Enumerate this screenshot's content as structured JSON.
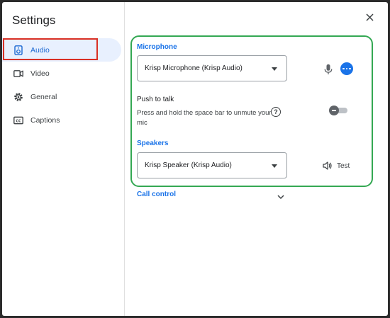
{
  "title": "Settings",
  "close_icon": "close-icon",
  "sidebar": {
    "items": [
      {
        "label": "Audio",
        "icon": "speaker-icon",
        "active": true
      },
      {
        "label": "Video",
        "icon": "video-camera-icon"
      },
      {
        "label": "General",
        "icon": "gear-icon"
      },
      {
        "label": "Captions",
        "icon": "closed-captions-icon"
      }
    ]
  },
  "audio": {
    "microphone": {
      "label": "Microphone",
      "selected": "Krisp Microphone (Krisp Audio)"
    },
    "push_to_talk": {
      "title": "Push to talk",
      "description": "Press and hold the space bar to unmute your mic",
      "enabled": false
    },
    "speakers": {
      "label": "Speakers",
      "selected": "Krisp Speaker (Krisp Audio)",
      "test_label": "Test"
    },
    "call_control": {
      "label": "Call control"
    }
  },
  "colors": {
    "accent": "#1a73e8",
    "active_nav_bg": "#e8f0fe",
    "highlight_red": "#d93025",
    "highlight_green": "#34a853"
  }
}
